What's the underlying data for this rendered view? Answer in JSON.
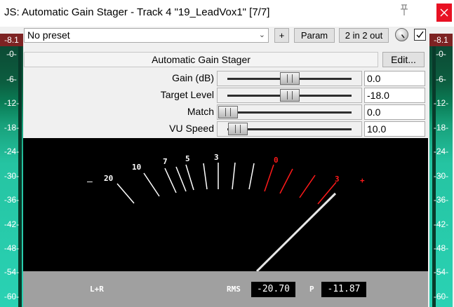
{
  "window": {
    "title": "JS: Automatic Gain Stager - Track 4 \"19_LeadVox1\" [7/7]"
  },
  "toolbar": {
    "preset_value": "No preset",
    "plus_label": "+",
    "param_label": "Param",
    "io_label": "2 in 2 out",
    "enabled": true
  },
  "effect": {
    "name": "Automatic Gain Stager",
    "edit_label": "Edit..."
  },
  "params": [
    {
      "label": "Gain (dB)",
      "value": "0.0",
      "level": 0.5
    },
    {
      "label": "Target Level",
      "value": "-18.0",
      "level": 0.5
    },
    {
      "label": "Match",
      "value": "0.0",
      "level": 0.0
    },
    {
      "label": "VU Speed",
      "value": "10.0",
      "level": 0.08
    }
  ],
  "meters": {
    "peak_left": "-8.1",
    "peak_right": "-8.1",
    "scale": [
      "-0-",
      "-6-",
      "-12-",
      "-18-",
      "-24-",
      "-30-",
      "-36-",
      "-42-",
      "-48-",
      "-54-",
      "-60-"
    ]
  },
  "vu": {
    "scale_labels": [
      "–",
      "20",
      "10",
      "7",
      "5",
      "3",
      "0",
      "3",
      "+"
    ],
    "needle_value_db": -20.7,
    "channel_label": "L+R",
    "rms_label": "RMS",
    "rms_value": "-20.70",
    "peak_label": "P",
    "peak_value": "-11.87",
    "white_color": "#ffffff",
    "red_color": "#ff1a1a"
  }
}
